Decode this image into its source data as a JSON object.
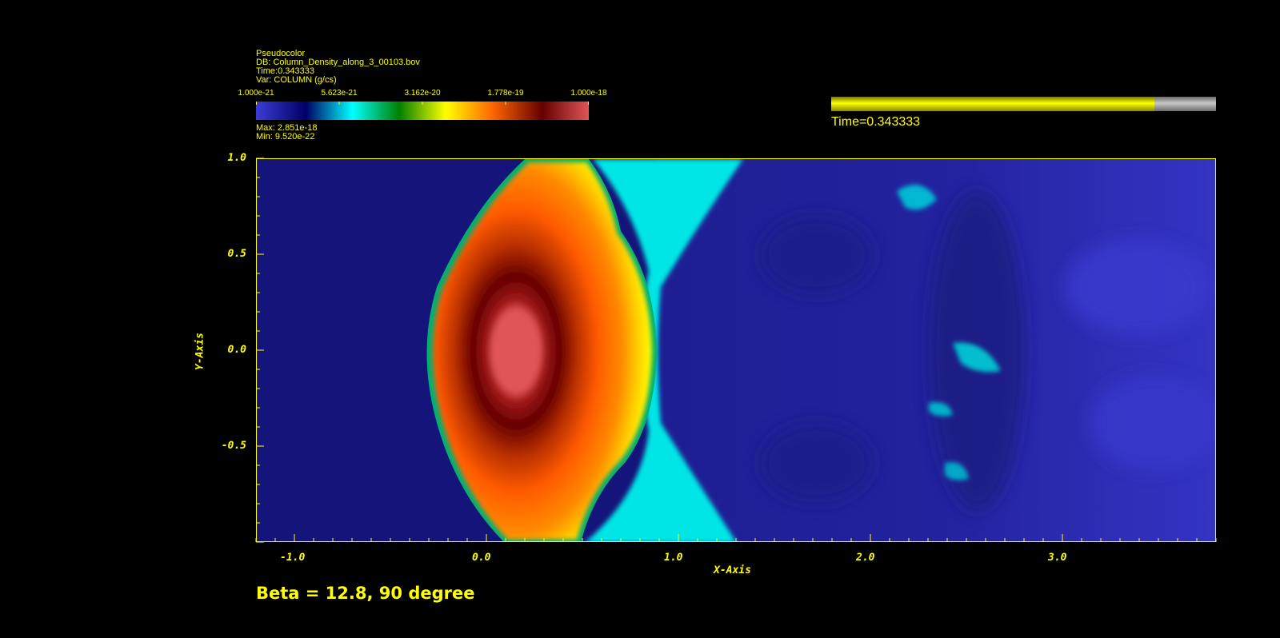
{
  "legend": {
    "plot_type": "Pseudocolor",
    "db_line": "DB: Column_Density_along_3_00103.bov",
    "time_line": "Time:0.343333",
    "var_line": "Var: COLUMN (g/cs)",
    "tick_labels": [
      "1.000e-21",
      "5.623e-21",
      "3.162e-20",
      "1.778e-19",
      "1.000e-18"
    ],
    "max_line": "Max:  2.851e-18",
    "min_line": "Min:  9.520e-22",
    "colormap": [
      "#3c3cd6",
      "#000066",
      "#00ffff",
      "#008000",
      "#ffff00",
      "#ff6600",
      "#660000",
      "#e05555"
    ]
  },
  "time_slider": {
    "label": "Time=0.343333",
    "fraction": 0.84,
    "fill_color": "#ffff00",
    "track_color": "#9a9a9a"
  },
  "annotation": "Beta = 12.8, 90 degree",
  "chart_data": {
    "type": "heatmap",
    "title": "",
    "xlabel": "X-Axis",
    "ylabel": "Y-Axis",
    "xlim": [
      -1.2,
      3.8
    ],
    "ylim": [
      -1.0,
      1.0
    ],
    "x_major_ticks": [
      -1.0,
      0.0,
      1.0,
      2.0,
      3.0
    ],
    "x_tick_labels": [
      "-1.0",
      "0.0",
      "1.0",
      "2.0",
      "3.0"
    ],
    "y_major_ticks": [
      -0.5,
      0.0,
      0.5,
      1.0
    ],
    "y_tick_labels": [
      "-0.5",
      "0.0",
      "0.5",
      "1.0"
    ],
    "variable": "COLUMN (g/cs)",
    "color_scale": "log",
    "color_range": [
      1e-21,
      1e-18
    ],
    "data_max": 2.851e-18,
    "data_min": 9.52e-22,
    "features": {
      "dense_core_center": [
        0.17,
        0.0
      ],
      "shock_front_leading_x": -0.33,
      "shock_front_trailing_x": 0.9,
      "background_color": "#14147a",
      "wake_color": "#2a2ab8"
    }
  }
}
